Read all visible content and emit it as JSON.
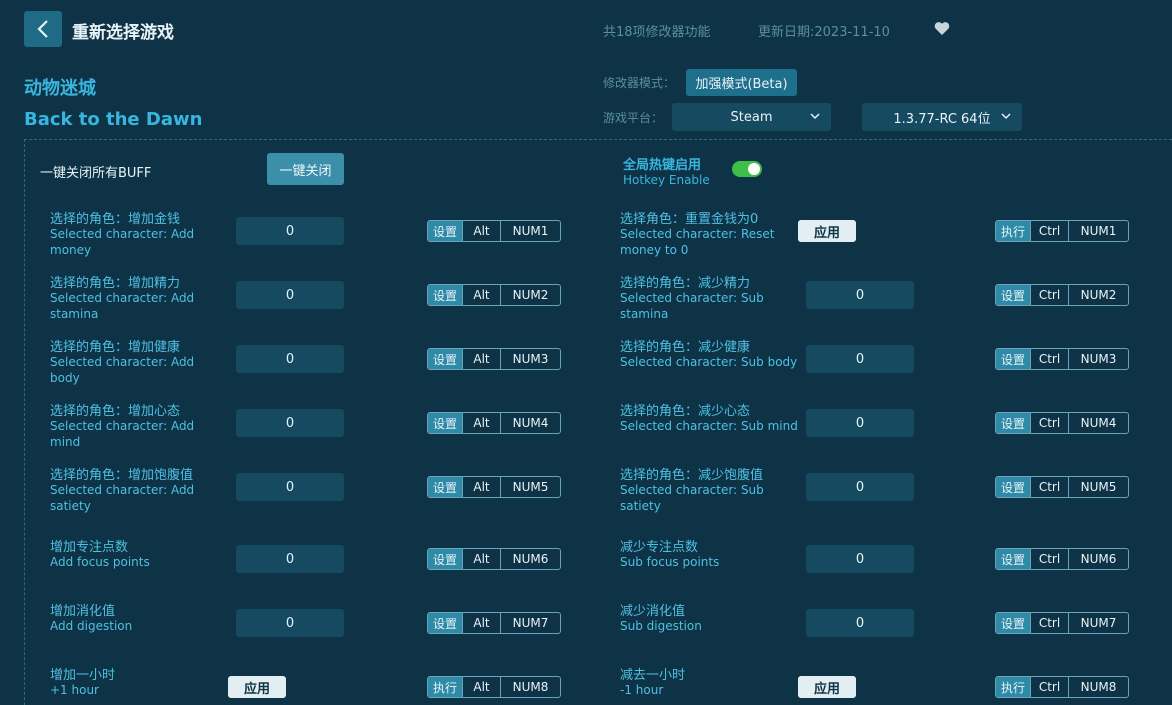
{
  "header": {
    "title": "重新选择游戏",
    "feature_count": "共18项修改器功能",
    "update_date": "更新日期:2023-11-10"
  },
  "game": {
    "name_cn": "动物迷城",
    "name_en": "Back to the Dawn"
  },
  "options": {
    "mode_label": "修改器模式：",
    "mode_value": "加强模式(Beta)",
    "platform_label": "游戏平台：",
    "platform_value": "Steam",
    "version_value": "1.3.77-RC 64位"
  },
  "global": {
    "close_all_label": "一键关闭所有BUFF",
    "close_all_button": "一键关闭",
    "hotkey_cn": "全局热键启用",
    "hotkey_en": "Hotkey Enable",
    "hotkey_enabled": true
  },
  "left_cheats": [
    {
      "cn": "选择的角色：增加金钱",
      "en": "Selected character: Add money",
      "value": "0",
      "action": "设置",
      "mod": "Alt",
      "key": "NUM1"
    },
    {
      "cn": "选择的角色：增加精力",
      "en": "Selected character: Add stamina",
      "value": "0",
      "action": "设置",
      "mod": "Alt",
      "key": "NUM2"
    },
    {
      "cn": "选择的角色：增加健康",
      "en": "Selected character: Add body",
      "value": "0",
      "action": "设置",
      "mod": "Alt",
      "key": "NUM3"
    },
    {
      "cn": "选择的角色：增加心态",
      "en": "Selected character: Add mind",
      "value": "0",
      "action": "设置",
      "mod": "Alt",
      "key": "NUM4"
    },
    {
      "cn": "选择的角色：增加饱腹值",
      "en": "Selected character: Add satiety",
      "value": "0",
      "action": "设置",
      "mod": "Alt",
      "key": "NUM5"
    },
    {
      "cn": "增加专注点数",
      "en": "Add focus points",
      "value": "0",
      "action": "设置",
      "mod": "Alt",
      "key": "NUM6"
    },
    {
      "cn": "增加消化值",
      "en": "Add digestion",
      "value": "0",
      "action": "设置",
      "mod": "Alt",
      "key": "NUM7"
    },
    {
      "cn": "增加一小时",
      "en": "+1 hour",
      "button": "应用",
      "action": "执行",
      "mod": "Alt",
      "key": "NUM8"
    }
  ],
  "right_cheats": [
    {
      "cn": "选择角色：重置金钱为0",
      "en": "Selected character: Reset money to 0",
      "button": "应用",
      "action": "执行",
      "mod": "Ctrl",
      "key": "NUM1"
    },
    {
      "cn": "选择的角色：减少精力",
      "en": "Selected character: Sub stamina",
      "value": "0",
      "action": "设置",
      "mod": "Ctrl",
      "key": "NUM2"
    },
    {
      "cn": "选择的角色：减少健康",
      "en": "Selected character: Sub body",
      "value": "0",
      "action": "设置",
      "mod": "Ctrl",
      "key": "NUM3"
    },
    {
      "cn": "选择的角色：减少心态",
      "en": "Selected character: Sub mind",
      "value": "0",
      "action": "设置",
      "mod": "Ctrl",
      "key": "NUM4"
    },
    {
      "cn": "选择的角色：减少饱腹值",
      "en": "Selected character: Sub satiety",
      "value": "0",
      "action": "设置",
      "mod": "Ctrl",
      "key": "NUM5"
    },
    {
      "cn": "减少专注点数",
      "en": "Sub focus points",
      "value": "0",
      "action": "设置",
      "mod": "Ctrl",
      "key": "NUM6"
    },
    {
      "cn": "减少消化值",
      "en": "Sub digestion",
      "value": "0",
      "action": "设置",
      "mod": "Ctrl",
      "key": "NUM7"
    },
    {
      "cn": "减去一小时",
      "en": "-1 hour",
      "button": "应用",
      "action": "执行",
      "mod": "Ctrl",
      "key": "NUM8"
    }
  ],
  "colors": {
    "background": "#0e3346",
    "accent": "#38b6e0",
    "toggle_on": "#3fbf4a"
  }
}
